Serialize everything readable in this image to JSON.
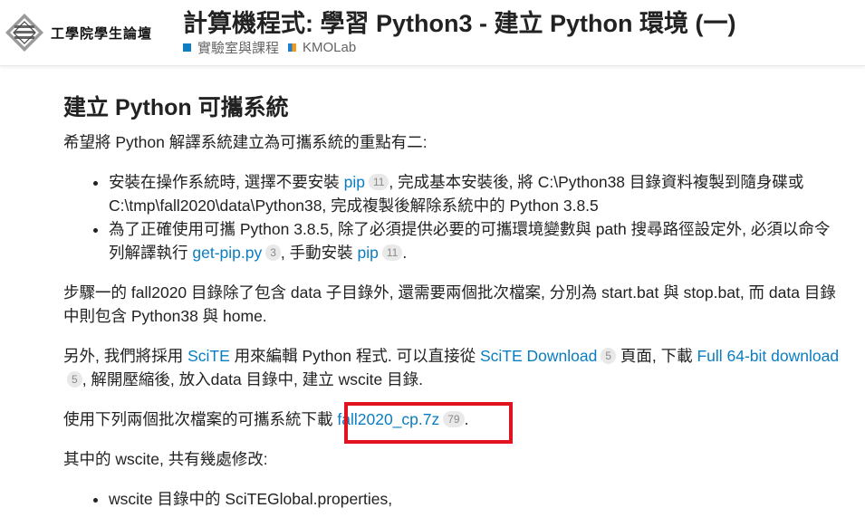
{
  "header": {
    "logo_text": "工學院學生論壇",
    "topic_title": "計算機程式: 學習 Python3 - 建立 Python 環境 (一)",
    "categories": [
      {
        "label": "實驗室與課程",
        "color": "#0f7dc2"
      },
      {
        "label": "KMOLab",
        "color_left": "#1f7fd0",
        "color_right": "#f09a1a"
      }
    ]
  },
  "post": {
    "heading": "建立 Python 可攜系統",
    "p1": "希望將 Python 解譯系統建立為可攜系統的重點有二:",
    "list1": {
      "item1": {
        "t1": "安裝在操作系統時, 選擇不要安裝 ",
        "link": "pip",
        "badge": "11",
        "t2": ", 完成基本安裝後, 將 C:\\Python38 目錄資料複製到隨身碟或 C:\\tmp\\fall2020\\data\\Python38, 完成複製後解除系統中的 Python 3.8.5"
      },
      "item2": {
        "t1": "為了正確使用可攜 Python 3.8.5, 除了必須提供必要的可攜環境變數與 path 搜尋路徑設定外, 必須以命令列解譯執行 ",
        "link1": "get-pip.py",
        "badge1": "3",
        "t2": ", 手動安裝 ",
        "link2": "pip",
        "badge2": "11",
        "t3": "."
      }
    },
    "p2": "步驟一的 fall2020 目錄除了包含 data 子目錄外, 還需要兩個批次檔案, 分別為 start.bat 與 stop.bat, 而 data 目錄中則包含 Python38 與 home.",
    "p3": {
      "t1": "另外, 我們將採用 ",
      "link1": "SciTE",
      "t2": " 用來編輯 Python 程式. 可以直接從 ",
      "link2": "SciTE Download",
      "badge2": "5",
      "t3": " 頁面, 下載 ",
      "link3": "Full 64-bit download",
      "badge3": "5",
      "t4": ", 解開壓縮後, 放入data 目錄中, 建立 wscite 目錄."
    },
    "p4": {
      "t1": "使用下列兩個批次檔案的可攜系統下載 ",
      "link": "fall2020_cp.7z",
      "badge": "79",
      "t2": "."
    },
    "p5": "其中的 wscite, 共有幾處修改:",
    "list2": {
      "item1": "wscite 目錄中的 SciTEGlobal.properties,"
    }
  },
  "colors": {
    "link": "#0a7dc2",
    "highlight": "#e0131e"
  }
}
